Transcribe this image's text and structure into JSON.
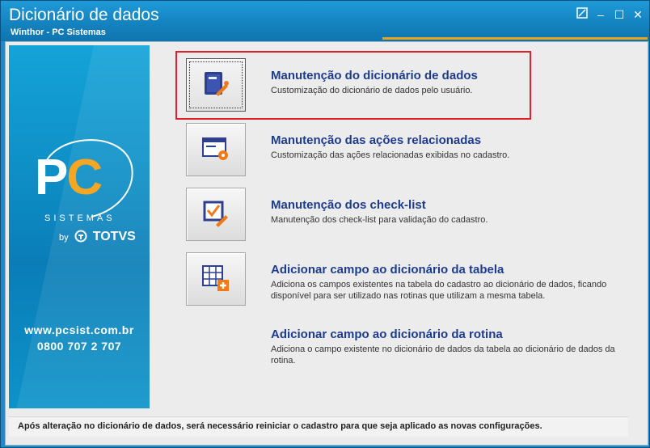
{
  "window": {
    "title": "Dicionário de dados",
    "subtitle": "Winthor - PC Sistemas",
    "controls": {
      "restore_icon": "restore-icon",
      "minimize_label": "–",
      "maximize_label": "☐",
      "close_label": "✕"
    }
  },
  "sidebar": {
    "logo_p": "P",
    "logo_c": "C",
    "logo_sub": "SISTEMAS",
    "by_text": "by",
    "totvs_text": "TOTVS",
    "website": "www.pcsist.com.br",
    "phone": "0800 707 2 707"
  },
  "items": [
    {
      "title": "Manutenção do dicionário de dados",
      "desc": "Customização do dicionário de dados pelo usuário.",
      "icon": "dictionary-edit-icon"
    },
    {
      "title": "Manutenção das ações relacionadas",
      "desc": "Customização das ações relacionadas exibidas no cadastro.",
      "icon": "window-gear-icon"
    },
    {
      "title": "Manutenção dos check-list",
      "desc": "Manutenção dos check-list para validação do cadastro.",
      "icon": "checklist-edit-icon"
    },
    {
      "title": "Adicionar campo ao dicionário da tabela",
      "desc": "Adiciona os campos existentes na tabela do cadastro ao dicionário de dados, ficando disponível para ser utilizado nas rotinas que utilizam a mesma tabela.",
      "icon": "table-add-icon"
    },
    {
      "title": "Adicionar campo ao dicionário da rotina",
      "desc": "Adiciona o campo existente no dicionário de dados da tabela ao dicionário de dados da rotina.",
      "icon": ""
    }
  ],
  "footer": {
    "text": "Após alteração no dicionário de dados, será necessário reiniciar o cadastro para que seja aplicado as novas configurações."
  },
  "colors": {
    "titlebar": "#1483c0",
    "accent_orange": "#e8a321",
    "item_title": "#1d3c8c",
    "highlight_border": "#e0202a"
  }
}
